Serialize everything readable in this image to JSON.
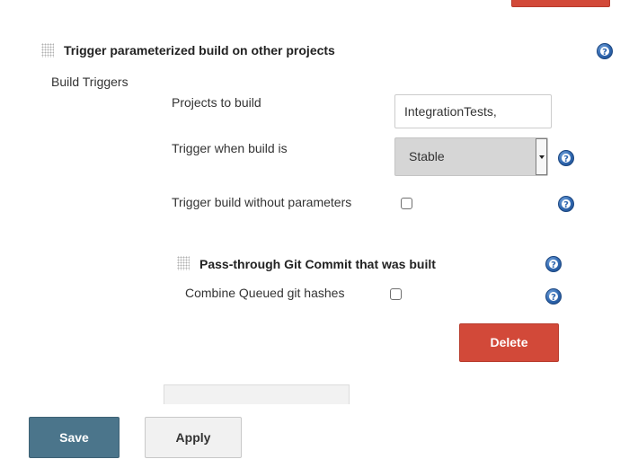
{
  "section": {
    "title": "Trigger parameterized build on other projects",
    "category_label": "Build Triggers"
  },
  "fields": {
    "projects_label": "Projects to build",
    "projects_value": "IntegrationTests,",
    "trigger_when_label": "Trigger when build is",
    "trigger_when_value": "Stable",
    "without_params_label": "Trigger build without parameters",
    "without_params_checked": false
  },
  "subsection": {
    "title": "Pass-through Git Commit that was built",
    "combine_label": "Combine Queued git hashes",
    "combine_checked": false,
    "delete_label": "Delete"
  },
  "footer": {
    "save_label": "Save",
    "apply_label": "Apply"
  },
  "icons": {
    "help": "help-icon",
    "drag": "drag-handle-icon",
    "dropdown": "chevron-down-icon"
  },
  "colors": {
    "danger": "#d24939",
    "primary": "#4b758b",
    "help": "#2f67b0"
  }
}
